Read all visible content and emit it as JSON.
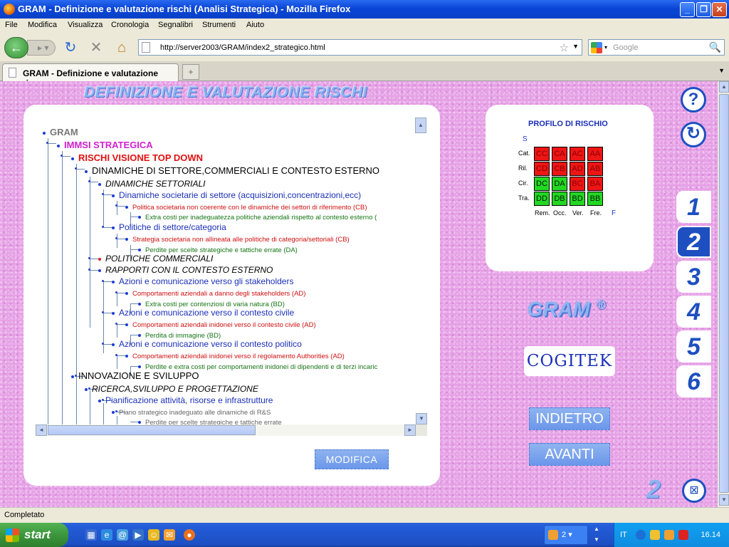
{
  "window": {
    "title": "GRAM - Definizione e valutazione rischi (Analisi Strategica) - Mozilla Firefox"
  },
  "menu": [
    "File",
    "Modifica",
    "Visualizza",
    "Cronologia",
    "Segnalibri",
    "Strumenti",
    "Aiuto"
  ],
  "nav": {
    "url": "http://server2003/GRAM/index2_strategico.html",
    "search_placeholder": "Google"
  },
  "tab": {
    "title": "GRAM - Definizione e valutazione ris..."
  },
  "page": {
    "title": "DEFINIZIONE E VALUTAZIONE RISCHI",
    "tree": [
      {
        "text": "GRAM"
      },
      {
        "text": "IMMSI STRATEGICA"
      },
      {
        "text": "RISCHI VISIONE TOP DOWN"
      },
      {
        "text": "DINAMICHE DI SETTORE,COMMERCIALI E CONTESTO ESTERNO"
      },
      {
        "text": "DINAMICHE SETTORIALI"
      },
      {
        "text": "Dinamiche societarie di settore (acquisizioni,concentrazioni,ecc)"
      },
      {
        "text": "Politica societaria non coerente con le dinamiche dei settori di riferimento   (CB)"
      },
      {
        "text": "Extra costi per inadeguatezza politiche aziendali rispetto al contesto esterno   ("
      },
      {
        "text": "Politiche di settore/categoria"
      },
      {
        "text": "Strategia societaria non allineata alle politiche di categoria/settoriali   (CB)"
      },
      {
        "text": "Perdite per scelte strategiche e tattiche errate   (DA)"
      },
      {
        "text": "POLITICHE COMMERCIALI"
      },
      {
        "text": "RAPPORTI CON IL CONTESTO ESTERNO"
      },
      {
        "text": "Azioni e comunicazione verso gli stakeholders"
      },
      {
        "text": "Comportamenti aziendali a danno degli stakeholders   (AD)"
      },
      {
        "text": "Extra costi per contenziosi di varia natura   (BD)"
      },
      {
        "text": "Azioni e comunicazione verso il contesto civile"
      },
      {
        "text": "Comportamenti aziendali inidonei verso il contesto civile   (AD)"
      },
      {
        "text": "Perdita di  immagine   (BD)"
      },
      {
        "text": "Azioni e comunicazione verso il contesto politico"
      },
      {
        "text": "Comportamenti aziendali inidonei verso il regolamento Authorities    (AD)"
      },
      {
        "text": "Perdite e extra costi per comportamenti inidonei di dipendenti e di terzi incaric"
      },
      {
        "text": "INNOVAZIONE E SVILUPPO"
      },
      {
        "text": "RICERCA,SVILUPPO E PROGETTAZIONE"
      },
      {
        "text": "Pianificazione attività, risorse e infrastrutture"
      },
      {
        "text": "Piano strategico inadeguato alle dinamiche di R&S"
      },
      {
        "text": "Perdite per scelte strategiche e tattiche errate"
      }
    ],
    "modifica_label": "MODIFICA",
    "risk": {
      "title": "PROFILO DI RISCHIO",
      "s_label": "S",
      "f_label": "F",
      "rows": [
        {
          "label": "Cat.",
          "cells": [
            "CC",
            "CA",
            "AC",
            "AA"
          ],
          "colors": [
            "red",
            "red",
            "red",
            "red"
          ]
        },
        {
          "label": "Ril.",
          "cells": [
            "CD",
            "CB",
            "AD",
            "AB"
          ],
          "colors": [
            "red",
            "red",
            "red",
            "red"
          ]
        },
        {
          "label": "Cir.",
          "cells": [
            "DC",
            "DA",
            "BC",
            "BA"
          ],
          "colors": [
            "green",
            "green",
            "red",
            "red"
          ]
        },
        {
          "label": "Tra.",
          "cells": [
            "DD",
            "DB",
            "BD",
            "BB"
          ],
          "colors": [
            "green",
            "green",
            "green",
            "green"
          ]
        }
      ],
      "cols": [
        "Rem.",
        "Occ.",
        "Ver.",
        "Fre."
      ],
      "colors": {
        "red": "#ee1515",
        "green": "#22d822"
      }
    },
    "brand": "GRAM",
    "brand_mark": "®",
    "logo": "COGITEK",
    "indietro_label": "INDIETRO",
    "avanti_label": "AVANTI",
    "side": {
      "help": "?",
      "refresh": "↻",
      "tabs": [
        "1",
        "2",
        "3",
        "4",
        "5",
        "6"
      ],
      "active_tab": "2",
      "close": "⊠"
    },
    "page_number": "2"
  },
  "status": {
    "text": "Completato"
  },
  "taskbar": {
    "start": "start",
    "item_count": "2",
    "lang": "IT",
    "clock": "16.14"
  }
}
